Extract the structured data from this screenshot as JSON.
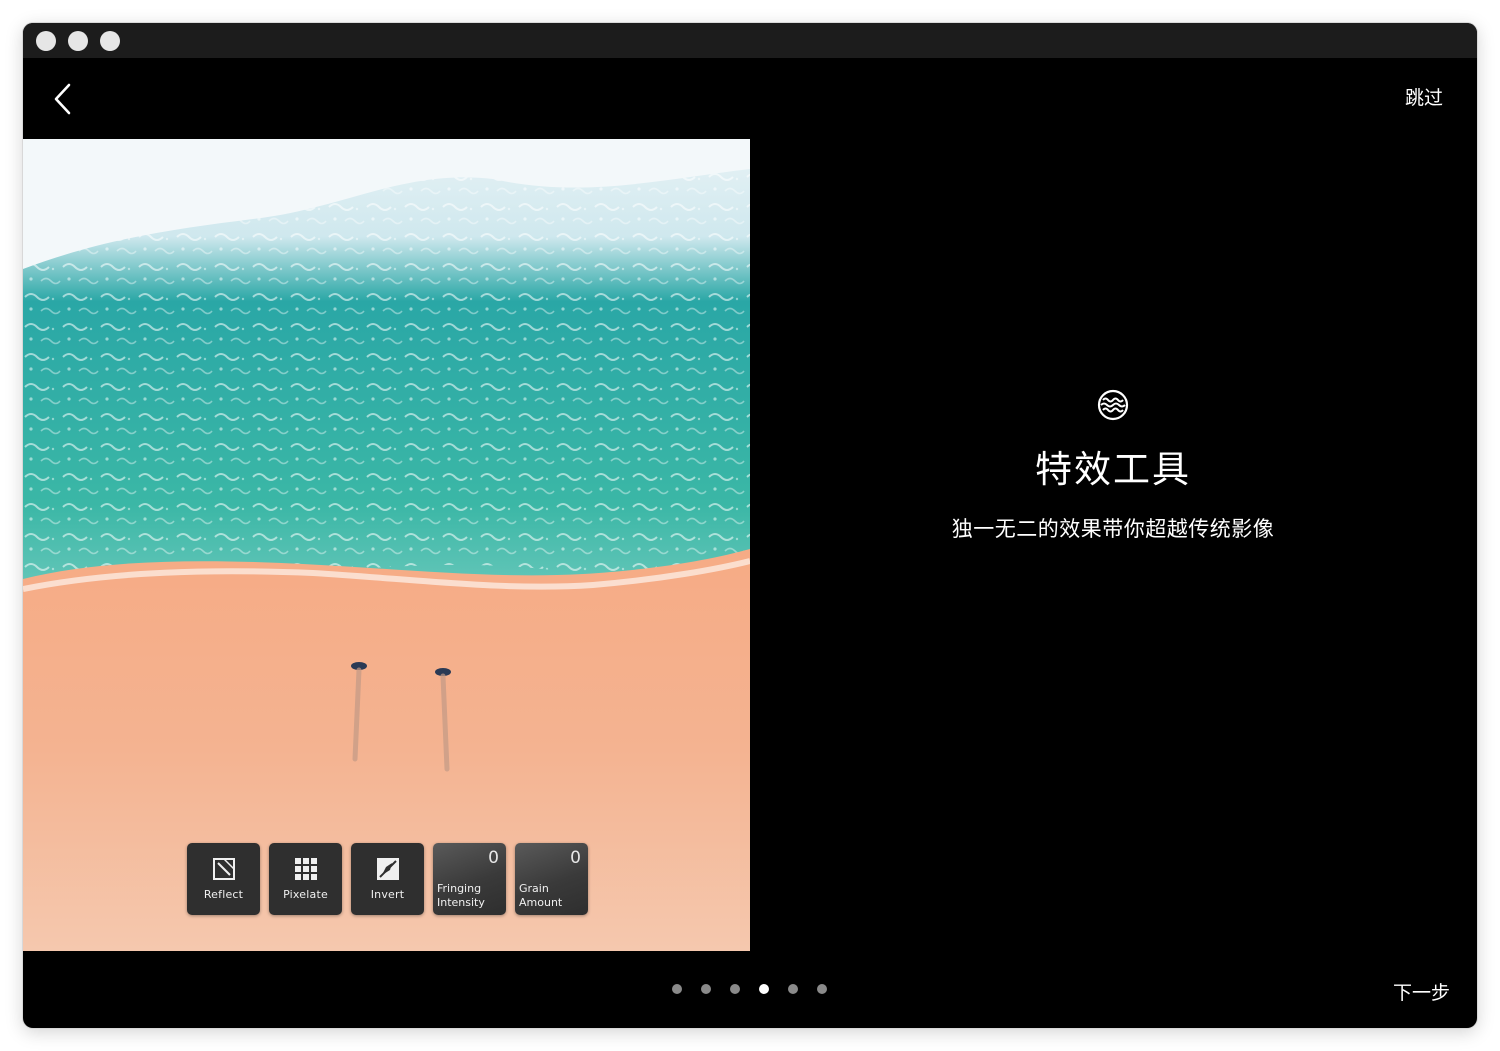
{
  "window": {
    "traffic_lights": [
      "close",
      "minimize",
      "zoom"
    ]
  },
  "nav": {
    "back_icon": "chevron-left-icon",
    "skip_label": "跳过",
    "next_label": "下一步"
  },
  "photo": {
    "description_icon": "beach-aerial-photo"
  },
  "tools": [
    {
      "label": "Reflect",
      "icon": "reflect-icon"
    },
    {
      "label": "Pixelate",
      "icon": "grid-icon"
    },
    {
      "label": "Invert",
      "icon": "invert-icon"
    }
  ],
  "sliders": [
    {
      "line1": "Fringing",
      "line2": "Intensity",
      "value": "0"
    },
    {
      "line1": "Grain",
      "line2": "Amount",
      "value": "0"
    }
  ],
  "feature": {
    "icon": "waves-icon",
    "title": "特效工具",
    "subtitle": "独一无二的效果带你超越传统影像"
  },
  "pager": {
    "count": 6,
    "active_index": 3
  },
  "colors": {
    "background": "#000000",
    "dot_inactive": "#8a8a8a",
    "dot_active": "#ffffff"
  }
}
